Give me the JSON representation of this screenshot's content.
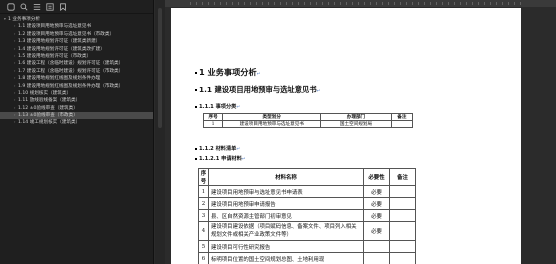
{
  "sidebar": {
    "toolbar_icons": [
      "folder-icon",
      "search-icon",
      "list-icon",
      "outline-icon",
      "bookmark-icon"
    ],
    "root": "1 业务事项分析",
    "items": [
      {
        "label": "1.1 建设项目用地预审与选址意见书",
        "selected": false
      },
      {
        "label": "1.2 建设项目用地预审与选址意见书（市政类）",
        "selected": false
      },
      {
        "label": "1.3 建设用地规划许可证（建筑类新建）",
        "selected": false
      },
      {
        "label": "1.4 建设用地规划许可证（建筑类改扩建）",
        "selected": false
      },
      {
        "label": "1.5 建设用地规划许可证（市政类）",
        "selected": false
      },
      {
        "label": "1.6 建设工程（含临时建设）规划许可证（建筑类）",
        "selected": false
      },
      {
        "label": "1.7 建设工程（含临时建设）规划许可证（市政类）",
        "selected": false
      },
      {
        "label": "1.8 建设用地规划红线图及规划条件办理",
        "selected": false
      },
      {
        "label": "1.9 建设用地规划红线图及规划条件办理（市政类）",
        "selected": false
      },
      {
        "label": "1.10 规划核实（建筑类）",
        "selected": false
      },
      {
        "label": "1.11 放线验线备案（建筑类）",
        "selected": false
      },
      {
        "label": "1.12 ±0验线审查（建筑类）",
        "selected": false
      },
      {
        "label": "1.13 ±0验线审查（市政类）",
        "selected": true
      },
      {
        "label": "1.14 竣工规划核实（建筑类）",
        "selected": false
      }
    ]
  },
  "document": {
    "h1": "1 业务事项分析",
    "h2": "1.1 建设项目用地预审与选址意见书",
    "h3_category": "1.1.1 事项分类",
    "table1": {
      "headers": [
        "序号",
        "类型划分",
        "办理部门",
        "备注"
      ],
      "rows": [
        [
          "1",
          "建设项目用地预审与选址意见书",
          "国土空间规划局",
          ""
        ]
      ]
    },
    "h3_materials": "1.1.2 材料清单",
    "h4_apply": "1.1.2.1 申请材料",
    "table2": {
      "headers": [
        "序号",
        "材料名称",
        "必要性",
        "备注"
      ],
      "rows": [
        [
          "1",
          "建设项目用地预审与选址意见书申请表",
          "必要",
          ""
        ],
        [
          "2",
          "建设项目用地预审申请报告",
          "必要",
          ""
        ],
        [
          "3",
          "县、区自然资源主管部门初审意见",
          "必要",
          ""
        ],
        [
          "4",
          "建设项目建设依据（项目赋码信息、备案文件、项目列入相关规划文件或相关产业政策文件等）",
          "必要",
          ""
        ],
        [
          "5",
          "建设项目可行性研究报告",
          "",
          ""
        ],
        [
          "6",
          "标明项目位置的国土空间规划总图、土地利用现",
          "",
          ""
        ]
      ]
    }
  }
}
